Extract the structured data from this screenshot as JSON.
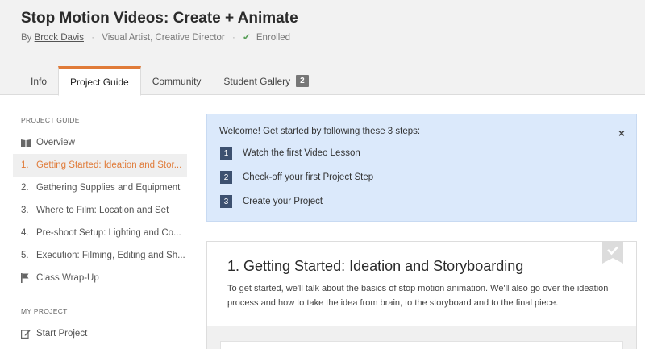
{
  "course": {
    "title": "Stop Motion Videos: Create + Animate",
    "by": "By",
    "author": "Brock Davis",
    "role": "Visual Artist, Creative Director",
    "status": "Enrolled"
  },
  "tabs": [
    {
      "label": "Info"
    },
    {
      "label": "Project Guide"
    },
    {
      "label": "Community"
    },
    {
      "label": "Student Gallery",
      "badge": "2"
    }
  ],
  "sidebar": {
    "heading": "PROJECT GUIDE",
    "overview": "Overview",
    "steps": [
      {
        "num": "1.",
        "label": "Getting Started: Ideation and Stor..."
      },
      {
        "num": "2.",
        "label": "Gathering Supplies and Equipment"
      },
      {
        "num": "3.",
        "label": "Where to Film: Location and Set"
      },
      {
        "num": "4.",
        "label": "Pre-shoot Setup: Lighting and Co..."
      },
      {
        "num": "5.",
        "label": "Execution: Filming, Editing and Sh..."
      }
    ],
    "wrapup": "Class Wrap-Up",
    "my_project_heading": "MY PROJECT",
    "start_project": "Start Project"
  },
  "welcome": {
    "title": "Welcome! Get started by following these 3 steps:",
    "close": "×",
    "steps": [
      {
        "n": "1",
        "label": "Watch the first Video Lesson"
      },
      {
        "n": "2",
        "label": "Check-off your first Project Step"
      },
      {
        "n": "3",
        "label": "Create your Project"
      }
    ]
  },
  "lesson": {
    "title": "1. Getting Started: Ideation and Storyboarding",
    "body": "To get started, we'll talk about the basics of stop motion animation. We'll also go over the ideation process and how to take the idea from brain, to the storyboard and to the final piece."
  },
  "colors": {
    "accent": "#e07b39",
    "welcome_bg": "#dbe9fb",
    "step_badge": "#3d5170"
  }
}
